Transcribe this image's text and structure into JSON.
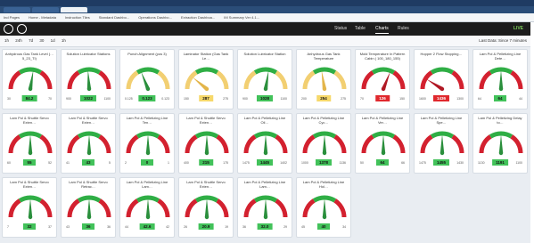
{
  "browser": {
    "bookmarks": [
      "Ind Pages",
      "Home - Metadata",
      "Instruction Tiles",
      "Standard Dashbo...",
      "Operations Dashbo...",
      "Extraction Dashboa...",
      "IM Summary Ver 4.1..."
    ]
  },
  "app": {
    "nav": [
      "Status",
      "Table",
      "Charts",
      "Rules"
    ],
    "active_nav": "Charts",
    "status": "LIVE"
  },
  "filters": {
    "ranges": [
      "1h",
      "24h",
      "7d",
      "30",
      "1d",
      "1h"
    ],
    "refresh": "Last Data: Since 7 minutes"
  },
  "colors": {
    "green": "#2fae45",
    "red": "#d3212f",
    "yellow": "#f2cf72",
    "value_green": "#42c25a",
    "value_red": "#e0282d",
    "value_yellow": "#f6d86a"
  },
  "gauges": [
    {
      "title": "Anhydrous Gas Tank Level (…5_23_TI)",
      "value": "84.2",
      "min": "30",
      "max": "70",
      "needle": 0.55,
      "value_color": "green",
      "arc": "red-green-red"
    },
    {
      "title": "Solution Lubricator Stations",
      "value": "1022",
      "min": "900",
      "max": "1100",
      "needle": 0.48,
      "value_color": "green",
      "arc": "red-green-red"
    },
    {
      "title": "Punch Alignment (pos 3)",
      "value": "0.123",
      "min": "0.125",
      "max": "0.123",
      "needle": 0.38,
      "value_color": "green",
      "arc": "yellow-green-yellow"
    },
    {
      "title": "Laminator Station (Gas Tank Le…",
      "value": "287",
      "min": "150",
      "max": "275",
      "needle": 0.22,
      "value_color": "yellow",
      "arc": "yellow-green-yellow"
    },
    {
      "title": "Solution Lubricator Station",
      "value": "1028",
      "min": "900",
      "max": "1100",
      "needle": 0.55,
      "value_color": "green",
      "arc": "yellow-green-yellow"
    },
    {
      "title": "Anhydrous Gas Tank Temperature",
      "value": "254",
      "min": "200",
      "max": "275",
      "needle": 0.45,
      "value_color": "yellow",
      "arc": "yellow-green-yellow"
    },
    {
      "title": "Mold Temperature In Pattern Cabin ( 100_180_155)",
      "value": "126",
      "min": "70",
      "max": "150",
      "needle": 0.62,
      "value_color": "red",
      "arc": "red-green-red"
    },
    {
      "title": "Hopper 2 Flow Stopping…",
      "value": "1436",
      "min": "1600",
      "max": "1300",
      "needle": 0.18,
      "value_color": "red",
      "arc": "red-green-red"
    },
    {
      "title": "Lam Pol & Pelletizing Line Dete…",
      "value": "64",
      "min": "64",
      "max": "44",
      "needle": 0.5,
      "value_color": "green",
      "arc": "red-green-red"
    },
    {
      "title": "Lam Pol & Shuttle Servo Exten…",
      "value": "55",
      "min": "60",
      "max": "52",
      "needle": 0.5,
      "value_color": "green",
      "arc": "red-green-red"
    },
    {
      "title": "Lam Pol & Shuttle Servo Exten…",
      "value": "43",
      "min": "41",
      "max": "5",
      "needle": 0.5,
      "value_color": "green",
      "arc": "red-green-red"
    },
    {
      "title": "Lam Pol & Pelletizing Line Ten…",
      "value": "0",
      "min": "2",
      "max": "1",
      "needle": 0.5,
      "value_color": "green",
      "arc": "red-green-red"
    },
    {
      "title": "Lam Pol & Shuttle Servo Exten…",
      "value": "215",
      "min": "400",
      "max": "175",
      "needle": 0.5,
      "value_color": "green",
      "arc": "red-green-red"
    },
    {
      "title": "Lam Pol & Pelletizing Line Oil…",
      "value": "1445",
      "min": "1475",
      "max": "1402",
      "needle": 0.5,
      "value_color": "green",
      "arc": "red-green-red"
    },
    {
      "title": "Lam Pol & Pelletizing Line Cyc…",
      "value": "1378",
      "min": "1000",
      "max": "1136",
      "needle": 0.5,
      "value_color": "green",
      "arc": "red-green-red"
    },
    {
      "title": "Lam Pol & Pelletizing Line Ver…",
      "value": "64",
      "min": "50",
      "max": "66",
      "needle": 0.5,
      "value_color": "green",
      "arc": "red-green-red"
    },
    {
      "title": "Lam Pol & Pelletizing Line Spe…",
      "value": "1455",
      "min": "1475",
      "max": "1430",
      "needle": 0.5,
      "value_color": "green",
      "arc": "red-green-red"
    },
    {
      "title": "Lam Pol & Pelletizing Delay to…",
      "value": "1191",
      "min": "1130",
      "max": "1100",
      "needle": 0.5,
      "value_color": "green",
      "arc": "red-green-red"
    },
    {
      "title": "Lam Pol & Shuttle Servo Exten…",
      "value": "32",
      "min": "7",
      "max": "37",
      "needle": 0.5,
      "value_color": "green",
      "arc": "red-green-red"
    },
    {
      "title": "Lam Pol & Shuttle Servo Retrac…",
      "value": "36",
      "min": "43",
      "max": "36",
      "needle": 0.5,
      "value_color": "green",
      "arc": "red-green-red"
    },
    {
      "title": "Lam Pol & Pelletizing Line Lam…",
      "value": "42.6",
      "min": "44",
      "max": "42",
      "needle": 0.5,
      "value_color": "green",
      "arc": "red-green-red"
    },
    {
      "title": "Lam Pol & Shuttle Servo Exten…",
      "value": "20.9",
      "min": "26",
      "max": "19",
      "needle": 0.5,
      "value_color": "green",
      "arc": "red-green-red"
    },
    {
      "title": "Lam Pol & Pelletizing Line Lam…",
      "value": "32.0",
      "min": "36",
      "max": "29",
      "needle": 0.5,
      "value_color": "green",
      "arc": "red-green-red"
    },
    {
      "title": "Lam Pol & Pelletizing Line Hol…",
      "value": "40",
      "min": "45",
      "max": "34",
      "needle": 0.5,
      "value_color": "green",
      "arc": "red-green-red"
    }
  ]
}
